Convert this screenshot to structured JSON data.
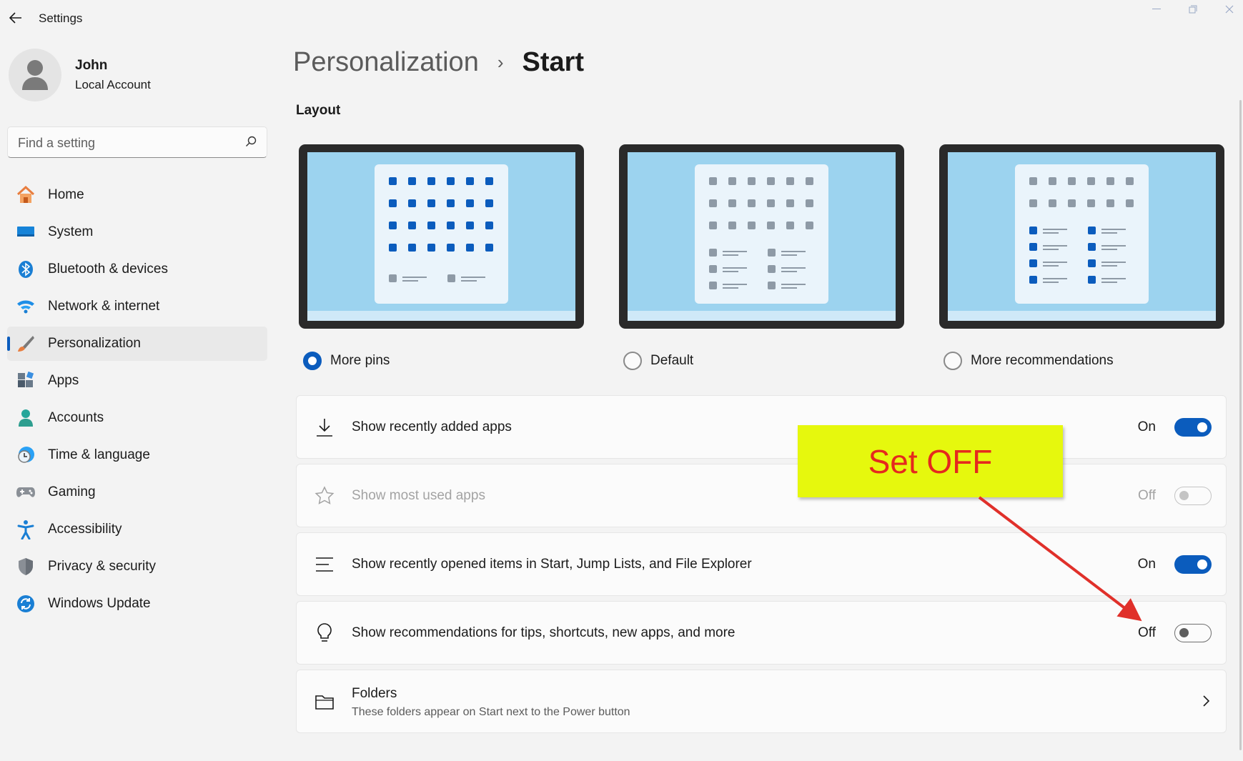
{
  "window": {
    "title": "Settings",
    "controls": [
      "minimize-icon",
      "maximize-icon",
      "close-icon"
    ]
  },
  "profile": {
    "name": "John",
    "account_type": "Local Account"
  },
  "search": {
    "placeholder": "Find a setting"
  },
  "sidebar": {
    "items": [
      {
        "label": "Home",
        "icon": "home-icon"
      },
      {
        "label": "System",
        "icon": "system-icon"
      },
      {
        "label": "Bluetooth & devices",
        "icon": "bluetooth-icon"
      },
      {
        "label": "Network & internet",
        "icon": "wifi-icon"
      },
      {
        "label": "Personalization",
        "icon": "brush-icon",
        "selected": true
      },
      {
        "label": "Apps",
        "icon": "apps-icon"
      },
      {
        "label": "Accounts",
        "icon": "person-icon"
      },
      {
        "label": "Time & language",
        "icon": "clock-icon"
      },
      {
        "label": "Gaming",
        "icon": "gamepad-icon"
      },
      {
        "label": "Accessibility",
        "icon": "accessibility-icon"
      },
      {
        "label": "Privacy & security",
        "icon": "shield-icon"
      },
      {
        "label": "Windows Update",
        "icon": "update-icon"
      }
    ]
  },
  "breadcrumb": {
    "parent": "Personalization",
    "separator": "›",
    "current": "Start"
  },
  "layout": {
    "title": "Layout",
    "options": [
      {
        "label": "More pins",
        "selected": true
      },
      {
        "label": "Default",
        "selected": false
      },
      {
        "label": "More recommendations",
        "selected": false
      }
    ]
  },
  "settings": [
    {
      "label": "Show recently added apps",
      "icon": "download-icon",
      "state": "On",
      "on": true,
      "disabled": false
    },
    {
      "label": "Show most used apps",
      "icon": "star-icon",
      "state": "Off",
      "on": false,
      "disabled": true
    },
    {
      "label": "Show recently opened items in Start, Jump Lists, and File Explorer",
      "icon": "list-icon",
      "state": "On",
      "on": true,
      "disabled": false
    },
    {
      "label": "Show recommendations for tips, shortcuts, new apps, and more",
      "icon": "lightbulb-icon",
      "state": "Off",
      "on": false,
      "disabled": false
    },
    {
      "label": "Folders",
      "description": "These folders appear on Start next to the Power button",
      "icon": "folder-icon"
    }
  ],
  "annotation": {
    "text": "Set OFF"
  },
  "colors": {
    "accent": "#0b5cbd",
    "callout_bg": "#e6f80d",
    "callout_text": "#e5291e",
    "arrow": "#e0302a"
  }
}
